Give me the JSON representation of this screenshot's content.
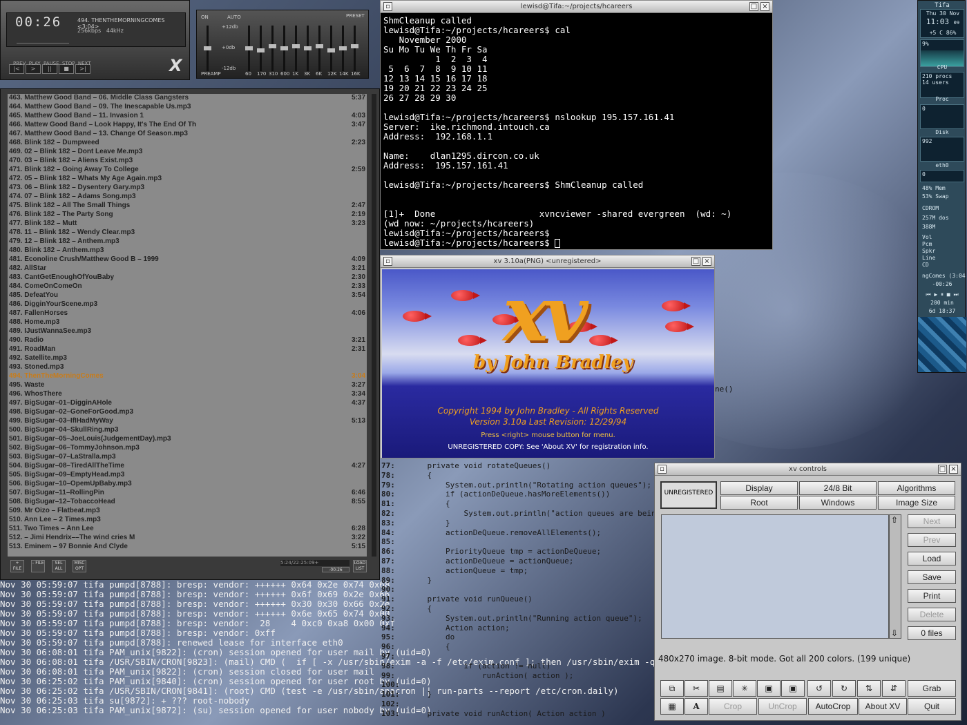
{
  "xmms": {
    "time": "00:26",
    "song": "494. THENTHEMORNINGCOMES <3:04>",
    "rate": "256kbps   44kHz",
    "btn_labels": "PREV  PLAY  PAUSE  STOP  NEXT",
    "logo": "X"
  },
  "eq": {
    "on": "ON",
    "auto": "AUTO",
    "preset": "PRESET",
    "preamp": "PREAMP",
    "db_top": "+12db",
    "db_mid": "+0db",
    "db_bot": "-12db",
    "bands": [
      "60",
      "170",
      "310",
      "600",
      "1K",
      "3K",
      "6K",
      "12K",
      "14K",
      "16K"
    ],
    "levels": [
      0.5,
      0.55,
      0.45,
      0.5,
      0.45,
      0.5,
      0.45,
      0.55,
      0.5,
      0.45
    ]
  },
  "playlist": {
    "items": [
      {
        "t": "463. Matthew Good Band – 06. Middle Class Gangsters",
        "d": "5:37"
      },
      {
        "t": "464. Matthew Good Band – 09. The Inescapable Us.mp3",
        "d": ""
      },
      {
        "t": "465. Matthew Good Band – 11. Invasion 1",
        "d": "4:03"
      },
      {
        "t": "466. Mattew Good Band – Look Happy, It's The End Of Th",
        "d": "3:47"
      },
      {
        "t": "467. Matthew Good Band – 13. Change Of Season.mp3",
        "d": ""
      },
      {
        "t": "468. Blink 182 – Dumpweed",
        "d": "2:23"
      },
      {
        "t": "469. 02 – Blink 182 – Dont Leave Me.mp3",
        "d": ""
      },
      {
        "t": "470. 03 – Blink 182 – Aliens Exist.mp3",
        "d": ""
      },
      {
        "t": "471. Blink 182 – Going Away To College",
        "d": "2:59"
      },
      {
        "t": "472. 05 – Blink 182 – Whats My Age Again.mp3",
        "d": ""
      },
      {
        "t": "473. 06 – Blink 182 – Dysentery Gary.mp3",
        "d": ""
      },
      {
        "t": "474. 07 – Blink 182 – Adams Song.mp3",
        "d": ""
      },
      {
        "t": "475. Blink 182 – All The Small Things",
        "d": "2:47"
      },
      {
        "t": "476. Blink 182 – The Party Song",
        "d": "2:19"
      },
      {
        "t": "477. Blink 182 – Mutt",
        "d": "3:23"
      },
      {
        "t": "478. 11 – Blink 182 – Wendy Clear.mp3",
        "d": ""
      },
      {
        "t": "479. 12 – Blink 182 – Anthem.mp3",
        "d": ""
      },
      {
        "t": "480. Blink 182 – Anthem.mp3",
        "d": ""
      },
      {
        "t": "481. Econoline Crush/Matthew Good B – 1999",
        "d": "4:09"
      },
      {
        "t": "482. AllStar",
        "d": "3:21"
      },
      {
        "t": "483. CantGetEnoughOfYouBaby",
        "d": "2:30"
      },
      {
        "t": "484. ComeOnComeOn",
        "d": "2:33"
      },
      {
        "t": "485. DefeatYou",
        "d": "3:54"
      },
      {
        "t": "486. DigginYourScene.mp3",
        "d": ""
      },
      {
        "t": "487. FallenHorses",
        "d": "4:06"
      },
      {
        "t": "488. Home.mp3",
        "d": ""
      },
      {
        "t": "489. IJustWannaSee.mp3",
        "d": ""
      },
      {
        "t": "490. Radio",
        "d": "3:21"
      },
      {
        "t": "491. RoadMan",
        "d": "2:31"
      },
      {
        "t": "492. Satellite.mp3",
        "d": ""
      },
      {
        "t": "493. Stoned.mp3",
        "d": ""
      },
      {
        "t": "494. ThenTheMorningComes",
        "d": "3:04",
        "cur": true
      },
      {
        "t": "495. Waste",
        "d": "3:27"
      },
      {
        "t": "496. WhosThere",
        "d": "3:34"
      },
      {
        "t": "497. BigSugar–01–DigginAHole",
        "d": "4:37"
      },
      {
        "t": "498. BigSugar–02–GoneForGood.mp3",
        "d": ""
      },
      {
        "t": "499. BigSugar–03–IfIHadMyWay",
        "d": "5:13"
      },
      {
        "t": "500. BigSugar–04–SkullRing.mp3",
        "d": ""
      },
      {
        "t": "501. BigSugar–05–JoeLouis(JudgementDay).mp3",
        "d": ""
      },
      {
        "t": "502. BigSugar–06–TommyJohnson.mp3",
        "d": ""
      },
      {
        "t": "503. BigSugar–07–LaStralla.mp3",
        "d": ""
      },
      {
        "t": "504. BigSugar–08–TiredAllTheTime",
        "d": "4:27"
      },
      {
        "t": "505. BigSugar–09–EmptyHead.mp3",
        "d": ""
      },
      {
        "t": "506. BigSugar–10–OpemUpBaby.mp3",
        "d": ""
      },
      {
        "t": "507. BigSugar–11–RollingPin",
        "d": "6:46"
      },
      {
        "t": "508. BigSugar–12–TobaccoHead",
        "d": "8:55"
      },
      {
        "t": "509. Mr Oizo – Flatbeat.mp3",
        "d": ""
      },
      {
        "t": "510. Ann Lee – 2 Times.mp3",
        "d": ""
      },
      {
        "t": "511. Two Times – Ann Lee",
        "d": "6:28"
      },
      {
        "t": "512.  – Jimi Hendrix––The wind cries M",
        "d": "3:22"
      },
      {
        "t": "513. Eminem – 97 Bonnie And Clyde",
        "d": "5:15"
      }
    ],
    "btn_add": "+ FILE",
    "btn_sub": "– FILE",
    "btn_sel": "SEL ALL",
    "btn_misc": "MISC OPT",
    "btn_load": "LOAD LIST",
    "time_readout": "5:24/22:25:09+",
    "time_small": "-00:26"
  },
  "log": {
    "lines": [
      "Nov 30 05:59:07 tifa pumpd[8788]: bresp: vendor: ++++++ 0x64 0x2e 0x74 0x68",
      "Nov 30 05:59:07 tifa pumpd[8788]: bresp: vendor: ++++++ 0x6f 0x69 0x2e 0x66",
      "Nov 30 05:59:07 tifa pumpd[8788]: bresp: vendor: ++++++ 0x30 0x30 0x66 0x2e",
      "Nov 30 05:59:07 tifa pumpd[8788]: bresp: vendor: ++++++ 0x6e 0x65 0x74 0x00",
      "Nov 30 05:59:07 tifa pumpd[8788]: bresp: vendor:  28    4 0xc0 0xa8 0x00 0xf",
      "Nov 30 05:59:07 tifa pumpd[8788]: bresp: vendor: 0xff",
      "Nov 30 05:59:07 tifa pumpd[8788]: renewed lease for interface eth0",
      "Nov 30 06:08:01 tifa PAM_unix[9822]: (cron) session opened for user mail by (uid=0)",
      "Nov 30 06:08:01 tifa /USR/SBIN/CRON[9823]: (mail) CMD (  if [ -x /usr/sbin/exim -a -f /etc/exim.conf ]; then /usr/sbin/exim -q >/dev/nu",
      "Nov 30 06:08:01 tifa PAM_unix[9822]: (cron) session closed for user mail",
      "Nov 30 06:25:02 tifa PAM_unix[9840]: (cron) session opened for user root by (uid=0)",
      "Nov 30 06:25:02 tifa /USR/SBIN/CRON[9841]: (root) CMD (test -e /usr/sbin/anacron || run-parts --report /etc/cron.daily)",
      "Nov 30 06:25:03 tifa su[9872]: + ??? root-nobody",
      "Nov 30 06:25:03 tifa PAM_unix[9872]: (su) session opened for user nobody by (uid=0)"
    ]
  },
  "terminal": {
    "title": "lewisd@Tifa:~/projects/hcareers",
    "lines": [
      "ShmCleanup called",
      "lewisd@Tifa:~/projects/hcareers$ cal",
      "   November 2000",
      "Su Mo Tu We Th Fr Sa",
      "          1  2  3  4",
      " 5  6  7  8  9 10 11",
      "12 13 14 15 16 17 18",
      "19 20 21 22 23 24 25",
      "26 27 28 29 30",
      "",
      "lewisd@Tifa:~/projects/hcareers$ nslookup 195.157.161.41",
      "Server:  ike.richmond.intouch.ca",
      "Address:  192.168.1.1",
      "",
      "Name:    dlan1295.dircon.co.uk",
      "Address:  195.157.161.41",
      "",
      "lewisd@Tifa:~/projects/hcareers$ ShmCleanup called",
      "",
      "",
      "[1]+  Done                    xvncviewer -shared evergreen  (wd: ~)",
      "(wd now: ~/projects/hcareers)",
      "lewisd@Tifa:~/projects/hcareers$",
      "lewisd@Tifa:~/projects/hcareers$ "
    ]
  },
  "xv": {
    "title": "xv 3.10a(PNG) <unregistered>",
    "logo": "xv",
    "by": "by John Bradley",
    "copyright": "Copyright 1994 by John Bradley - All Rights Reserved",
    "version": "Version 3.10a      Last Revision: 12/29/94",
    "press": "Press <right> mouse button for menu.",
    "unreg": "UNREGISTERED COPY:  See 'About XV' for registration info."
  },
  "code": {
    "lines": [
      {
        "n": "77:",
        "c": "    private void rotateQueues()"
      },
      {
        "n": "78:",
        "c": "    {"
      },
      {
        "n": "79:",
        "c": "        System.out.println(\"Rotating action queues\");"
      },
      {
        "n": "80:",
        "c": "        if (actionDeQueue.hasMoreElements())"
      },
      {
        "n": "81:",
        "c": "        {"
      },
      {
        "n": "82:",
        "c": "            System.out.println(\"action queues are bein"
      },
      {
        "n": "83:",
        "c": "        }"
      },
      {
        "n": "84:",
        "c": "        actionDeQueue.removeAllElements();"
      },
      {
        "n": "85:",
        "c": ""
      },
      {
        "n": "86:",
        "c": "        PriorityQueue tmp = actionDeQueue;"
      },
      {
        "n": "87:",
        "c": "        actionDeQueue = actionQueue;"
      },
      {
        "n": "88:",
        "c": "        actionQueue = tmp;"
      },
      {
        "n": "89:",
        "c": "    }"
      },
      {
        "n": "90:",
        "c": ""
      },
      {
        "n": "91:",
        "c": "    private void runQueue()"
      },
      {
        "n": "92:",
        "c": "    {"
      },
      {
        "n": "93:",
        "c": "        System.out.println(\"Running action queue\");"
      },
      {
        "n": "94:",
        "c": "        Action action;"
      },
      {
        "n": "95:",
        "c": "        do"
      },
      {
        "n": "96:",
        "c": "        {"
      },
      {
        "n": "97:",
        "c": ""
      },
      {
        "n": "98:",
        "c": "            if (action != null)"
      },
      {
        "n": "99:",
        "c": "                runAction( action );"
      },
      {
        "n": "100:",
        "c": ""
      },
      {
        "n": "101:",
        "c": "    }"
      },
      {
        "n": "102:",
        "c": ""
      },
      {
        "n": "103:",
        "c": "    private void runAction( Action action )"
      }
    ],
    "extra": "ne()"
  },
  "controls": {
    "title": "xv controls",
    "unreg": "UNREGISTERED",
    "row1": [
      "Display",
      "24/8 Bit",
      "Algorithms"
    ],
    "row2": [
      "Root",
      "Windows",
      "Image Size"
    ],
    "side": [
      "Next",
      "Prev",
      "Load",
      "Save",
      "Print",
      "Delete",
      "0 files"
    ],
    "status": "480x270 image.  8-bit mode.  Got all 200 colors.  (199 unique)",
    "bottom": [
      "Crop",
      "UnCrop",
      "AutoCrop",
      "About XV",
      "Quit"
    ],
    "grab": "Grab"
  },
  "gkrellm": {
    "host": "Tifa",
    "date": "Thu 30 Nov",
    "time": "11:03",
    "sec": "09",
    "load": "+5  C 86%",
    "cpu_pct": "9%",
    "cpu": "CPU",
    "procs": "210 procs",
    "users": "14  users",
    "proc": "Proc",
    "proc_val": "0",
    "disk": "Disk",
    "disk_val": "992",
    "eth": "eth0",
    "eth_val": "0",
    "mem": "48%  Mem",
    "swap": "53%  Swap",
    "cdrom": "CDROM",
    "dos1": "257M  dos",
    "dos2": "388M",
    "vol": "Vol",
    "pcm": "Pcm",
    "spkr": "Spkr",
    "line": "Line",
    "cd": "CD",
    "song": "ngComes (3:04",
    "songtime": "-00:26",
    "uptime": "200 min",
    "uptime2": "6d 18:37"
  }
}
